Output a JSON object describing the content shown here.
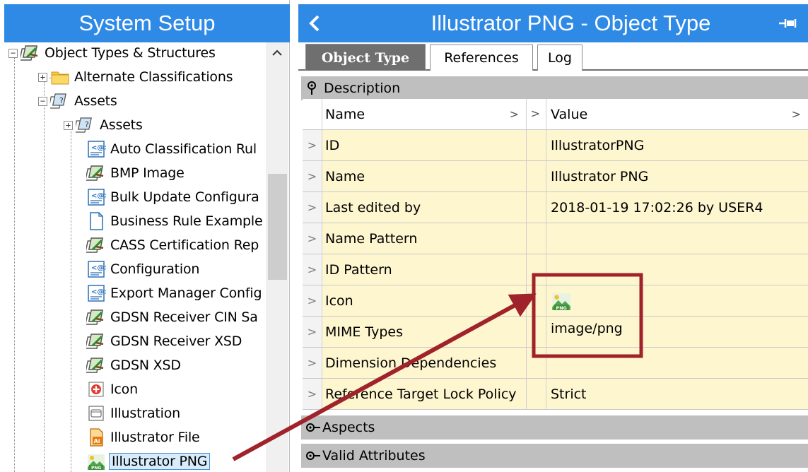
{
  "left_panel": {
    "title": "System Setup",
    "tree": [
      {
        "label": "Object Types & Structures",
        "expander": "−",
        "icon": "object-type-icon"
      },
      {
        "label": "Alternate Classifications",
        "expander": "+",
        "icon": "folder-icon"
      },
      {
        "label": "Assets",
        "expander": "−",
        "icon": "asset-type-icon"
      },
      {
        "label": "Assets",
        "expander": "+",
        "icon": "asset-type-icon"
      },
      {
        "label": "Auto Classification Rul",
        "expander": "",
        "icon": "configuration-icon"
      },
      {
        "label": "BMP Image",
        "expander": "",
        "icon": "object-type-icon"
      },
      {
        "label": "Bulk Update Configura",
        "expander": "",
        "icon": "configuration-icon"
      },
      {
        "label": "Business Rule Example",
        "expander": "",
        "icon": "document-icon"
      },
      {
        "label": "CASS Certification Rep",
        "expander": "",
        "icon": "object-type-icon"
      },
      {
        "label": "Configuration",
        "expander": "",
        "icon": "configuration-icon"
      },
      {
        "label": "Export Manager Config",
        "expander": "",
        "icon": "configuration-icon"
      },
      {
        "label": "GDSN Receiver CIN Sa",
        "expander": "",
        "icon": "object-type-icon"
      },
      {
        "label": "GDSN Receiver XSD",
        "expander": "",
        "icon": "object-type-icon"
      },
      {
        "label": "GDSN XSD",
        "expander": "",
        "icon": "object-type-icon"
      },
      {
        "label": "Icon",
        "expander": "",
        "icon": "icon-type-icon"
      },
      {
        "label": "Illustration",
        "expander": "",
        "icon": "illustration-icon"
      },
      {
        "label": "Illustrator File",
        "expander": "",
        "icon": "illustrator-file-icon"
      },
      {
        "label": "Illustrator PNG",
        "expander": "",
        "icon": "png-icon",
        "selected": true
      }
    ]
  },
  "right_panel": {
    "title": "Illustrator PNG - Object Type",
    "tabs": [
      "Object Type",
      "References",
      "Log"
    ],
    "active_tab": "Object Type",
    "sections": {
      "description": "Description",
      "aspects": "Aspects",
      "valid_attributes": "Valid Attributes"
    },
    "table_header": {
      "name": "Name",
      "value": "Value"
    },
    "properties": [
      {
        "name": "ID",
        "value": "IllustratorPNG"
      },
      {
        "name": "Name",
        "value": "Illustrator PNG"
      },
      {
        "name": "Last edited by",
        "value": "2018-01-19 17:02:26 by USER4"
      },
      {
        "name": "Name Pattern",
        "value": ""
      },
      {
        "name": "ID Pattern",
        "value": ""
      },
      {
        "name": "Icon",
        "value": "",
        "value_icon": "png-icon"
      },
      {
        "name": "MIME Types",
        "value": "image/png"
      },
      {
        "name": "Dimension Dependencies",
        "value": ""
      },
      {
        "name": "Reference Target Lock Policy",
        "value": "Strict"
      }
    ]
  },
  "colors": {
    "header_blue": "#2f8ae6",
    "row_yellow": "#fef6cf",
    "section_gray": "#bfbfbf",
    "annotation_red": "#a0222a"
  }
}
